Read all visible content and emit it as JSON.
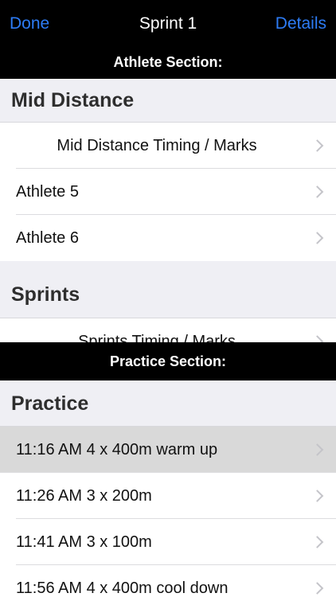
{
  "navbar": {
    "left_label": "Done",
    "title": "Sprint 1",
    "right_label": "Details"
  },
  "athlete_section": {
    "bar_label": "Athlete Section:",
    "groups": [
      {
        "header": "Mid Distance",
        "rows": [
          "Mid Distance Timing / Marks",
          "Athlete 5",
          "Athlete 6"
        ]
      },
      {
        "header": "Sprints",
        "rows": [
          "Sprints Timing / Marks"
        ]
      }
    ]
  },
  "practice_section": {
    "bar_label": "Practice Section:",
    "header": "Practice",
    "rows": [
      "11:16 AM 4 x 400m warm up",
      "11:26 AM 3 x 200m",
      "11:41 AM 3 x 100m",
      "11:56 AM 4 x 400m cool down"
    ]
  },
  "colors": {
    "accent": "#2d7cf6",
    "bar_background": "#000000",
    "group_header_background": "#efeff4",
    "selected_row": "#d9d9d9"
  },
  "icons": {
    "row_disclosure": "chevron-right-icon"
  }
}
